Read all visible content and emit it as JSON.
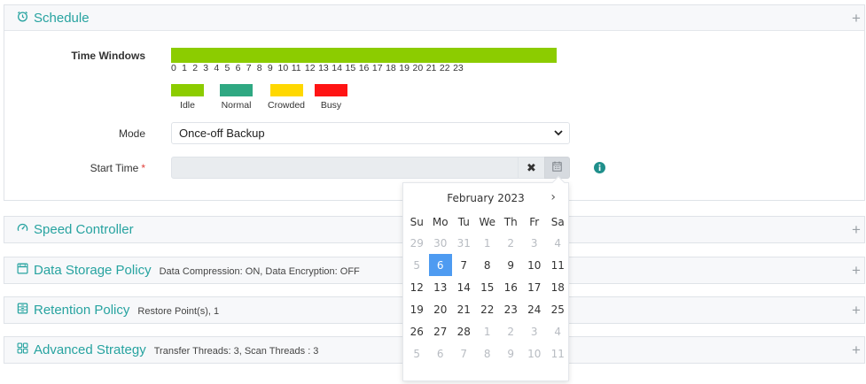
{
  "schedule": {
    "title": "Schedule",
    "time_windows_label": "Time Windows",
    "hours": [
      "0",
      "1",
      "2",
      "3",
      "4",
      "5",
      "6",
      "7",
      "8",
      "9",
      "10",
      "11",
      "12",
      "13",
      "14",
      "15",
      "16",
      "17",
      "18",
      "19",
      "20",
      "21",
      "22",
      "23"
    ],
    "legend": [
      {
        "label": "Idle",
        "color": "#8ccc00"
      },
      {
        "label": "Normal",
        "color": "#2fa882"
      },
      {
        "label": "Crowded",
        "color": "#ffd800"
      },
      {
        "label": "Busy",
        "color": "#ff1414"
      }
    ],
    "mode_label": "Mode",
    "mode_value": "Once-off Backup",
    "start_time_label": "Start Time",
    "required_marker": "*",
    "start_time_value": "",
    "clear_glyph": "✖"
  },
  "datepicker": {
    "month_label": "February 2023",
    "next_glyph": "›",
    "weekdays": [
      "Su",
      "Mo",
      "Tu",
      "We",
      "Th",
      "Fr",
      "Sa"
    ],
    "weeks": [
      [
        {
          "d": "29",
          "m": true
        },
        {
          "d": "30",
          "m": true
        },
        {
          "d": "31",
          "m": true
        },
        {
          "d": "1",
          "m": true
        },
        {
          "d": "2",
          "m": true
        },
        {
          "d": "3",
          "m": true
        },
        {
          "d": "4",
          "m": true
        }
      ],
      [
        {
          "d": "5",
          "m": true
        },
        {
          "d": "6",
          "a": true
        },
        {
          "d": "7"
        },
        {
          "d": "8"
        },
        {
          "d": "9"
        },
        {
          "d": "10"
        },
        {
          "d": "11"
        }
      ],
      [
        {
          "d": "12"
        },
        {
          "d": "13"
        },
        {
          "d": "14"
        },
        {
          "d": "15"
        },
        {
          "d": "16"
        },
        {
          "d": "17"
        },
        {
          "d": "18"
        }
      ],
      [
        {
          "d": "19"
        },
        {
          "d": "20"
        },
        {
          "d": "21"
        },
        {
          "d": "22"
        },
        {
          "d": "23"
        },
        {
          "d": "24"
        },
        {
          "d": "25"
        }
      ],
      [
        {
          "d": "26"
        },
        {
          "d": "27"
        },
        {
          "d": "28"
        },
        {
          "d": "1",
          "m": true
        },
        {
          "d": "2",
          "m": true
        },
        {
          "d": "3",
          "m": true
        },
        {
          "d": "4",
          "m": true
        }
      ],
      [
        {
          "d": "5",
          "m": true
        },
        {
          "d": "6",
          "m": true
        },
        {
          "d": "7",
          "m": true
        },
        {
          "d": "8",
          "m": true
        },
        {
          "d": "9",
          "m": true
        },
        {
          "d": "10",
          "m": true
        },
        {
          "d": "11",
          "m": true
        }
      ]
    ],
    "selected_date": "6"
  },
  "sections": {
    "speed": {
      "title": "Speed Controller",
      "summary": ""
    },
    "storage": {
      "title": "Data Storage Policy",
      "summary": "Data Compression: ON, Data Encryption: OFF"
    },
    "retention": {
      "title": "Retention Policy",
      "summary": "Restore Point(s), 1"
    },
    "advanced": {
      "title": "Advanced Strategy",
      "summary": "Transfer Threads: 3, Scan Threads : 3"
    }
  },
  "expand_glyph": "+",
  "accent_color": "#27a3a0"
}
